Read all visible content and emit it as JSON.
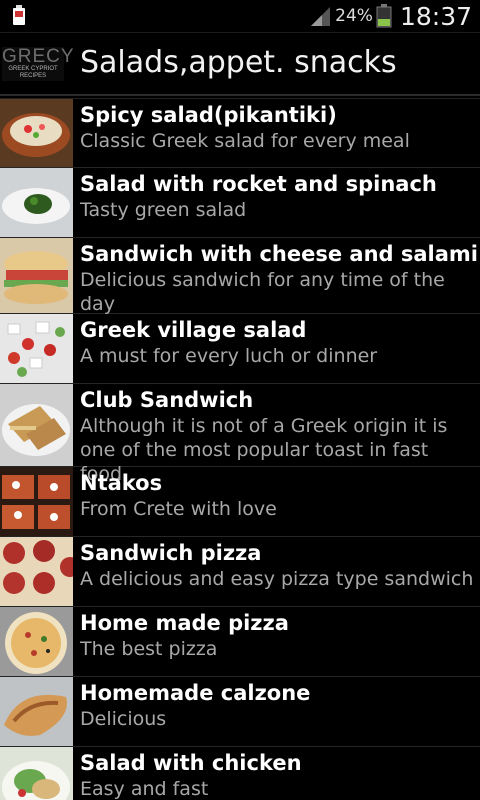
{
  "status_bar": {
    "battery_percent": "24%",
    "time": "18:37",
    "icons": [
      "sim-card-icon",
      "signal-icon",
      "battery-icon"
    ]
  },
  "action_bar": {
    "logo": {
      "line1": "GRECY",
      "line2": "GREEK CYPRIOT",
      "line3": "RECIPES"
    },
    "title": "Salads,appet. snacks"
  },
  "recipes": [
    {
      "title": "Spicy salad(pikantiki)",
      "subtitle": "Classic Greek salad for every meal",
      "thumb": "spicy-salad"
    },
    {
      "title": "Salad with rocket and spinach",
      "subtitle": "Tasty green salad",
      "thumb": "green-salad"
    },
    {
      "title": "Sandwich with cheese and salami",
      "subtitle": "Delicious sandwich for any time of the day",
      "thumb": "sandwich"
    },
    {
      "title": "Greek village salad",
      "subtitle": "A must for every luch or dinner",
      "thumb": "village-salad"
    },
    {
      "title": "Club Sandwich",
      "subtitle": "Although it is not of a Greek origin it is one of the most popular toast in fast food",
      "thumb": "club-sandwich"
    },
    {
      "title": "Ntakos",
      "subtitle": "From Crete with love",
      "thumb": "ntakos"
    },
    {
      "title": "Sandwich pizza",
      "subtitle": "A delicious and easy pizza type sandwich",
      "thumb": "sandwich-pizza"
    },
    {
      "title": "Home made pizza",
      "subtitle": "The best pizza",
      "thumb": "pizza"
    },
    {
      "title": "Homemade calzone",
      "subtitle": "Delicious",
      "thumb": "calzone"
    },
    {
      "title": "Salad with chicken",
      "subtitle": "Easy and fast",
      "thumb": "chicken-salad"
    }
  ]
}
